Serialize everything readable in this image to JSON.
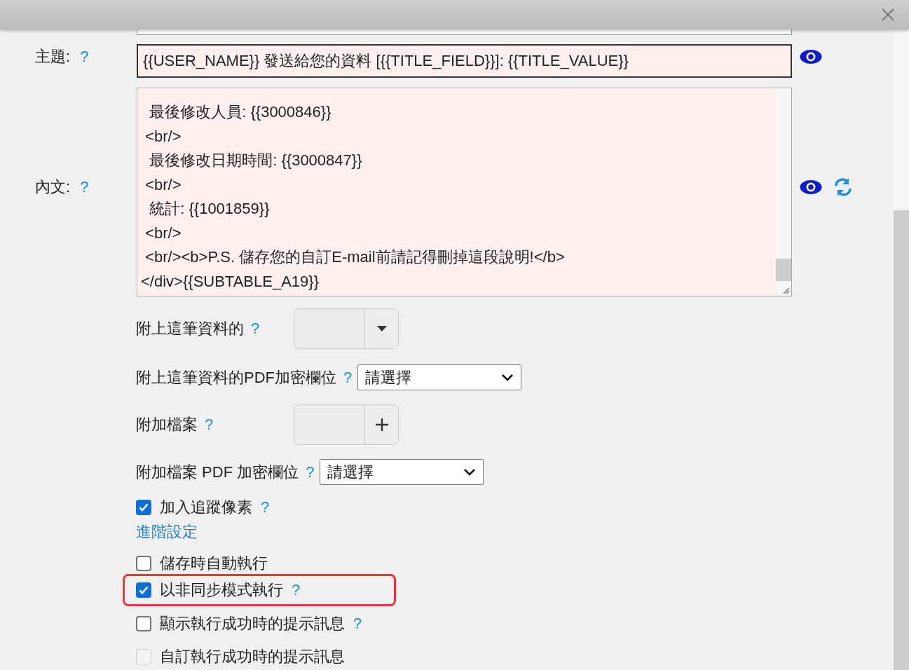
{
  "subject": {
    "label": "主題:",
    "help": "?",
    "value": "{{USER_NAME}} 發送給您的資料 [{{TITLE_FIELD}}]: {{TITLE_VALUE}}"
  },
  "body": {
    "label": "內文:",
    "help": "?",
    "lines": [
      "  最後修改人員: {{3000846}}",
      " <br/>",
      "  最後修改日期時間: {{3000847}}",
      " <br/>",
      "  統計: {{1001859}}",
      " <br/>",
      " <br/><b>P.S. 儲存您的自訂E-mail前請記得刪掉這段說明!</b>",
      "</div>{{SUBTABLE_A19}}"
    ]
  },
  "attachments": [
    {
      "kind": "picker",
      "label": "附上這筆資料的",
      "help": "?",
      "button": {
        "kind": "caret"
      }
    },
    {
      "kind": "select",
      "label": "附上這筆資料的PDF加密欄位",
      "help": "?",
      "value": "請選擇"
    },
    {
      "kind": "picker",
      "label": "附加檔案",
      "help": "?",
      "button": {
        "kind": "plus"
      }
    },
    {
      "kind": "select",
      "label": "附加檔案 PDF 加密欄位",
      "help": "?",
      "value": "請選擇"
    }
  ],
  "tracking": {
    "label": "加入追蹤像素",
    "help": "?",
    "checked": true
  },
  "advanced_link": "進階設定",
  "run_options": [
    {
      "label": "儲存時自動執行",
      "checked": false,
      "disabled": false,
      "highlighted": false
    },
    {
      "label": "以非同步模式執行",
      "help": "?",
      "checked": true,
      "disabled": false,
      "highlighted": true
    },
    {
      "label": "顯示執行成功時的提示訊息",
      "help": "?",
      "checked": false,
      "disabled": false,
      "highlighted": false
    },
    {
      "label": "自訂執行成功時的提示訊息",
      "checked": false,
      "disabled": true,
      "highlighted": false
    }
  ]
}
